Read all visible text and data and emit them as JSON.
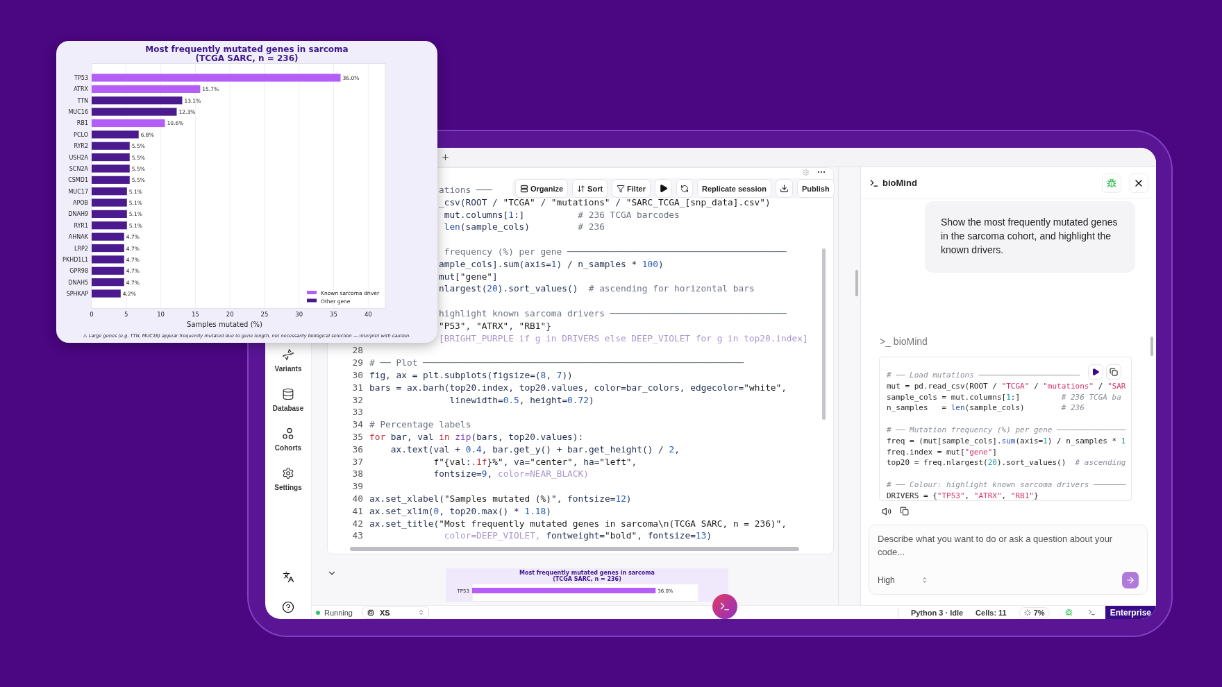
{
  "chart_card": {
    "chart_data": {
      "type": "bar",
      "orientation": "horizontal",
      "stacked": true,
      "grid": true,
      "legend": true,
      "title": "Most frequently mutated genes in sarcoma\n(TCGA SARC, n = 236)",
      "xlabel": "Samples mutated (%)",
      "categories": [
        "TP53",
        "ATRX",
        "TTN",
        "MUC16",
        "RB1",
        "PCLO",
        "RYR2",
        "USH2A",
        "SCN2A",
        "CSMD1",
        "MUC17",
        "APOB",
        "DNAH9",
        "RYR1",
        "AHNAK",
        "LRP2",
        "PKHD1L1",
        "GPR98",
        "DNAH5",
        "SPHKAP"
      ],
      "series": [
        {
          "name": "Known sarcoma driver",
          "color": "#b45ef7",
          "values": [
            36.0,
            15.7,
            null,
            null,
            10.6,
            null,
            null,
            null,
            null,
            null,
            null,
            null,
            null,
            null,
            null,
            null,
            null,
            null,
            null,
            null
          ]
        },
        {
          "name": "Other gene",
          "color": "#4a1a8e",
          "values": [
            null,
            null,
            13.1,
            12.3,
            null,
            6.8,
            5.5,
            5.5,
            5.5,
            5.5,
            5.1,
            5.1,
            5.1,
            5.1,
            4.7,
            4.7,
            4.7,
            4.7,
            4.7,
            4.2
          ]
        }
      ],
      "value_labels": [
        "36.0%",
        "15.7%",
        "13.1%",
        "12.3%",
        "10.6%",
        "6.8%",
        "5.5%",
        "5.5%",
        "5.5%",
        "5.5%",
        "5.1%",
        "5.1%",
        "5.1%",
        "5.1%",
        "4.7%",
        "4.7%",
        "4.7%",
        "4.7%",
        "4.7%",
        "4.2%"
      ],
      "xlim": [
        0,
        42.48
      ],
      "xticks": [
        0,
        5,
        10,
        15,
        20,
        25,
        30,
        35,
        40
      ]
    },
    "note": "⚠ Large genes (e.g. TTN, MUC16) appear frequently mutated due to gene length, not necessarily biological selection — interpret with caution."
  },
  "sidebar": {
    "items": [
      {
        "label": "Variants"
      },
      {
        "label": "Database"
      },
      {
        "label": "Cohorts"
      },
      {
        "label": "Settings"
      }
    ]
  },
  "editor": {
    "toolbar": [
      {
        "kind": "text",
        "label": "Organize"
      },
      {
        "kind": "text",
        "label": "Sort"
      },
      {
        "kind": "text",
        "label": "Filter"
      },
      {
        "kind": "icon"
      },
      {
        "kind": "icon"
      },
      {
        "kind": "text",
        "label": "Replicate session"
      },
      {
        "kind": "icon"
      },
      {
        "kind": "text",
        "label": "Publish"
      }
    ],
    "lines": [
      {
        "kind": "clipped",
        "code": [
          {
            "kind": "comment",
            "text": "ations ───"
          }
        ]
      },
      {
        "kind": "clipped",
        "code": [
          {
            "kind": "plain",
            "text": "_csv(ROOT / "
          },
          {
            "kind": "string",
            "text": "\"TCGA\""
          },
          {
            "kind": "plain",
            "text": " / "
          },
          {
            "kind": "string",
            "text": "\"mutations\""
          },
          {
            "kind": "plain",
            "text": " / "
          },
          {
            "kind": "string",
            "text": "\"SARC_TCGA_[snp_data].csv\""
          },
          {
            "kind": "plain",
            "text": ")"
          }
        ]
      },
      {
        "kind": "clipped",
        "code": [
          {
            "kind": "plain",
            "text": " mut.columns["
          },
          {
            "kind": "number",
            "text": "1"
          },
          {
            "kind": "plain",
            "text": ":]"
          },
          {
            "kind": "comment",
            "text": "          # 236 TCGA barcodes"
          }
        ]
      },
      {
        "kind": "clipped",
        "code": [
          {
            "kind": "func",
            "text": " len"
          },
          {
            "kind": "plain",
            "text": "(sample_cols)"
          },
          {
            "kind": "comment",
            "text": "         # 236"
          }
        ]
      },
      {
        "kind": "clipped"
      },
      {
        "kind": "clipped",
        "code": [
          {
            "kind": "comment",
            "text": " frequency (%) per gene ─────────────────────────────────────────"
          }
        ]
      },
      {
        "kind": "clipped",
        "code": [
          {
            "kind": "plain",
            "text": "ample_cols].sum(axis="
          },
          {
            "kind": "number",
            "text": "1"
          },
          {
            "kind": "plain",
            "text": ") / n_samples * "
          },
          {
            "kind": "number",
            "text": "100"
          },
          {
            "kind": "plain",
            "text": ")"
          }
        ]
      },
      {
        "kind": "clipped",
        "code": [
          {
            "kind": "plain",
            "text": "mut["
          },
          {
            "kind": "string",
            "text": "\"gene\""
          },
          {
            "kind": "plain",
            "text": "]"
          }
        ]
      },
      {
        "kind": "clipped",
        "code": [
          {
            "kind": "plain",
            "text": "nlargest("
          },
          {
            "kind": "number",
            "text": "20"
          },
          {
            "kind": "plain",
            "text": ").sort_values()"
          },
          {
            "kind": "comment",
            "text": "  # ascending for horizontal bars"
          }
        ]
      },
      {
        "kind": "clipped"
      },
      {
        "kind": "clipped",
        "code": [
          {
            "kind": "comment",
            "text": "highlight known sarcoma drivers ─────────────────────────────────"
          }
        ]
      },
      {
        "kind": "clipped",
        "code": [
          {
            "kind": "string",
            "text": "\"P53\""
          },
          {
            "kind": "plain",
            "text": ", "
          },
          {
            "kind": "string",
            "text": "\"ATRX\""
          },
          {
            "kind": "plain",
            "text": ", "
          },
          {
            "kind": "string",
            "text": "\"RB1\""
          },
          {
            "kind": "plain",
            "text": "}"
          }
        ]
      },
      {
        "kind": "clipped",
        "code": [
          {
            "kind": "blurred",
            "text": "[BRIGHT_PURPLE if g in DRIVERS else DEEP_VIOLET for g in top20.index]"
          }
        ]
      },
      {
        "kind": "full",
        "number": "28"
      },
      {
        "kind": "full",
        "number": "29",
        "code": [
          {
            "kind": "comment",
            "text": "# ── Plot ────────────────────────────────────────────────────────────"
          }
        ]
      },
      {
        "kind": "full",
        "number": "30",
        "code": [
          {
            "kind": "plain",
            "text": "fig, ax = plt.subplots(figsize=("
          },
          {
            "kind": "number",
            "text": "8"
          },
          {
            "kind": "plain",
            "text": ", "
          },
          {
            "kind": "number",
            "text": "7"
          },
          {
            "kind": "plain",
            "text": "))"
          }
        ]
      },
      {
        "kind": "full",
        "number": "31",
        "code": [
          {
            "kind": "plain",
            "text": "bars = ax.barh(top20.index, top20.values, color=bar_colors, edgecolor="
          },
          {
            "kind": "string",
            "text": "\"white\""
          },
          {
            "kind": "plain",
            "text": ","
          }
        ]
      },
      {
        "kind": "full",
        "number": "32",
        "code": [
          {
            "kind": "plain",
            "text": "               linewidth="
          },
          {
            "kind": "number",
            "text": "0.5"
          },
          {
            "kind": "plain",
            "text": ", height="
          },
          {
            "kind": "number",
            "text": "0.72"
          },
          {
            "kind": "plain",
            "text": ")"
          }
        ]
      },
      {
        "kind": "full",
        "number": "33"
      },
      {
        "kind": "full",
        "number": "34",
        "code": [
          {
            "kind": "comment",
            "text": "# Percentage labels"
          }
        ]
      },
      {
        "kind": "full",
        "number": "35",
        "code": [
          {
            "kind": "keyword",
            "text": "for"
          },
          {
            "kind": "plain",
            "text": " bar, val "
          },
          {
            "kind": "keyword",
            "text": "in"
          },
          {
            "kind": "builtin",
            "text": " zip"
          },
          {
            "kind": "plain",
            "text": "(bars, top20.values):"
          }
        ]
      },
      {
        "kind": "full",
        "number": "36",
        "code": [
          {
            "kind": "plain",
            "text": "    ax.text(val + "
          },
          {
            "kind": "number",
            "text": "0.4"
          },
          {
            "kind": "plain",
            "text": ", bar.get_y() + bar.get_height() / "
          },
          {
            "kind": "number",
            "text": "2"
          },
          {
            "kind": "plain",
            "text": ","
          }
        ]
      },
      {
        "kind": "full",
        "number": "37",
        "code": [
          {
            "kind": "string",
            "text": "            f\"{val:"
          },
          {
            "kind": "keyword",
            "text": ".1f"
          },
          {
            "kind": "string",
            "text": "}%\""
          },
          {
            "kind": "plain",
            "text": ", va="
          },
          {
            "kind": "string",
            "text": "\"center\""
          },
          {
            "kind": "plain",
            "text": ", ha="
          },
          {
            "kind": "string",
            "text": "\"left\""
          },
          {
            "kind": "plain",
            "text": ","
          }
        ]
      },
      {
        "kind": "full",
        "number": "38",
        "code": [
          {
            "kind": "plain",
            "text": "            fontsize="
          },
          {
            "kind": "number",
            "text": "9"
          },
          {
            "kind": "plain",
            "text": ", "
          },
          {
            "kind": "blurred",
            "text": "color=NEAR_BLACK)"
          }
        ]
      },
      {
        "kind": "full",
        "number": "39"
      },
      {
        "kind": "full",
        "number": "40",
        "code": [
          {
            "kind": "plain",
            "text": "ax.set_xlabel("
          },
          {
            "kind": "string",
            "text": "\"Samples mutated (%)\""
          },
          {
            "kind": "plain",
            "text": ", fontsize="
          },
          {
            "kind": "number",
            "text": "12"
          },
          {
            "kind": "plain",
            "text": ")"
          }
        ]
      },
      {
        "kind": "full",
        "number": "41",
        "code": [
          {
            "kind": "plain",
            "text": "ax.set_xlim("
          },
          {
            "kind": "number",
            "text": "0"
          },
          {
            "kind": "plain",
            "text": ", top20.max() * "
          },
          {
            "kind": "number",
            "text": "1.18"
          },
          {
            "kind": "plain",
            "text": ")"
          }
        ]
      },
      {
        "kind": "full",
        "number": "42",
        "code": [
          {
            "kind": "plain",
            "text": "ax.set_title("
          },
          {
            "kind": "string",
            "text": "\"Most frequently mutated genes in sarcoma\\n(TCGA SARC, n = 236)\""
          },
          {
            "kind": "plain",
            "text": ","
          }
        ]
      },
      {
        "kind": "full",
        "number": "43",
        "code": [
          {
            "kind": "blurred",
            "text": "              color=DEEP_VIOLET,"
          },
          {
            "kind": "plain",
            "text": " fontweight="
          },
          {
            "kind": "string",
            "text": "\"bold\""
          },
          {
            "kind": "plain",
            "text": ", fontsize="
          },
          {
            "kind": "number",
            "text": "13"
          },
          {
            "kind": "plain",
            "text": ")"
          }
        ]
      }
    ],
    "output": {
      "preview": {
        "title": "Most frequently mutated genes in sarcoma\n(TCGA SARC, n = 236)",
        "label": "TP53",
        "level": 0.847,
        "reading": "36.0%"
      }
    }
  },
  "assistant": {
    "title": "bioMind",
    "user_message": "Show the most frequently mutated genes in the sarcoma cohort, and highlight the known drivers.",
    "reply_label": ">_ bioMind",
    "reply_code": [
      {
        "kind": "code",
        "code": [
          {
            "kind": "comment",
            "text": "# ── Load mutations ──────────────────────"
          }
        ]
      },
      {
        "kind": "code",
        "code": [
          {
            "kind": "plain",
            "text": "mut = pd.read_csv(ROOT / "
          },
          {
            "kind": "string",
            "text": "\"TCGA\""
          },
          {
            "kind": "plain",
            "text": " / "
          },
          {
            "kind": "string",
            "text": "\"mutations\""
          },
          {
            "kind": "plain",
            "text": " / "
          },
          {
            "kind": "string",
            "text": "\"SAR"
          }
        ]
      },
      {
        "kind": "code",
        "code": [
          {
            "kind": "plain",
            "text": "sample_cols = mut.columns["
          },
          {
            "kind": "number",
            "text": "1"
          },
          {
            "kind": "plain",
            "text": ":]"
          },
          {
            "kind": "comment",
            "text": "         # 236 TCGA ba"
          }
        ]
      },
      {
        "kind": "code",
        "code": [
          {
            "kind": "plain",
            "text": "n_samples   = "
          },
          {
            "kind": "func",
            "text": "len"
          },
          {
            "kind": "plain",
            "text": "(sample_cols)"
          },
          {
            "kind": "comment",
            "text": "        # 236"
          }
        ]
      },
      {
        "kind": "blank"
      },
      {
        "kind": "code",
        "code": [
          {
            "kind": "comment",
            "text": "# ── Mutation frequency (%) per gene ───────────────"
          }
        ]
      },
      {
        "kind": "code",
        "code": [
          {
            "kind": "plain",
            "text": "freq = (mut[sample_cols]."
          },
          {
            "kind": "func",
            "text": "sum"
          },
          {
            "kind": "plain",
            "text": "(axis="
          },
          {
            "kind": "number",
            "text": "1"
          },
          {
            "kind": "plain",
            "text": ") / n_samples * "
          },
          {
            "kind": "number",
            "text": "1"
          }
        ]
      },
      {
        "kind": "code",
        "code": [
          {
            "kind": "plain",
            "text": "freq.index = mut["
          },
          {
            "kind": "string",
            "text": "\"gene\""
          },
          {
            "kind": "plain",
            "text": "]"
          }
        ]
      },
      {
        "kind": "code",
        "code": [
          {
            "kind": "plain",
            "text": "top20 = freq.nlargest("
          },
          {
            "kind": "number",
            "text": "20"
          },
          {
            "kind": "plain",
            "text": ").sort_values()"
          },
          {
            "kind": "comment",
            "text": "  # ascending"
          }
        ]
      },
      {
        "kind": "blank"
      },
      {
        "kind": "code",
        "code": [
          {
            "kind": "comment",
            "text": "# ── Colour: highlight known sarcoma drivers ───────"
          }
        ]
      },
      {
        "kind": "code",
        "code": [
          {
            "kind": "plain",
            "text": "DRIVERS = {"
          },
          {
            "kind": "string",
            "text": "\"TP53\""
          },
          {
            "kind": "plain",
            "text": ", "
          },
          {
            "kind": "string",
            "text": "\"ATRX\""
          },
          {
            "kind": "plain",
            "text": ", "
          },
          {
            "kind": "string",
            "text": "\"RB1\""
          },
          {
            "kind": "plain",
            "text": "}"
          }
        ]
      }
    ],
    "input": {
      "placeholder": "Describe what you want to do or ask a question about your code...",
      "effort": "High"
    }
  },
  "status_bar": {
    "state": "Running",
    "size": "XS",
    "kernel": "Python 3 · Idle",
    "cells": "Cells: 11",
    "progress": "7%",
    "plan": "Enterprise"
  }
}
